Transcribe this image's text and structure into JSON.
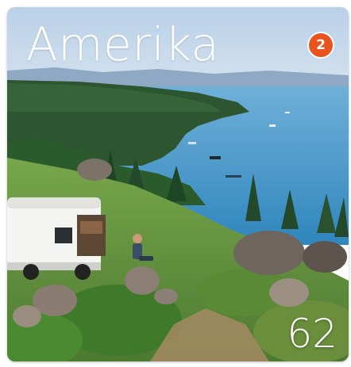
{
  "card": {
    "title": "Amerika",
    "badge": "2",
    "count": "62"
  },
  "colors": {
    "badge": "#e8531e",
    "sky": "#aac5e0",
    "lake": "#3e90c4",
    "forest": "#2f5a2e"
  },
  "icons": {
    "badge": "number-badge-icon",
    "van": "camper-van-icon",
    "person": "person-sitting-icon"
  }
}
